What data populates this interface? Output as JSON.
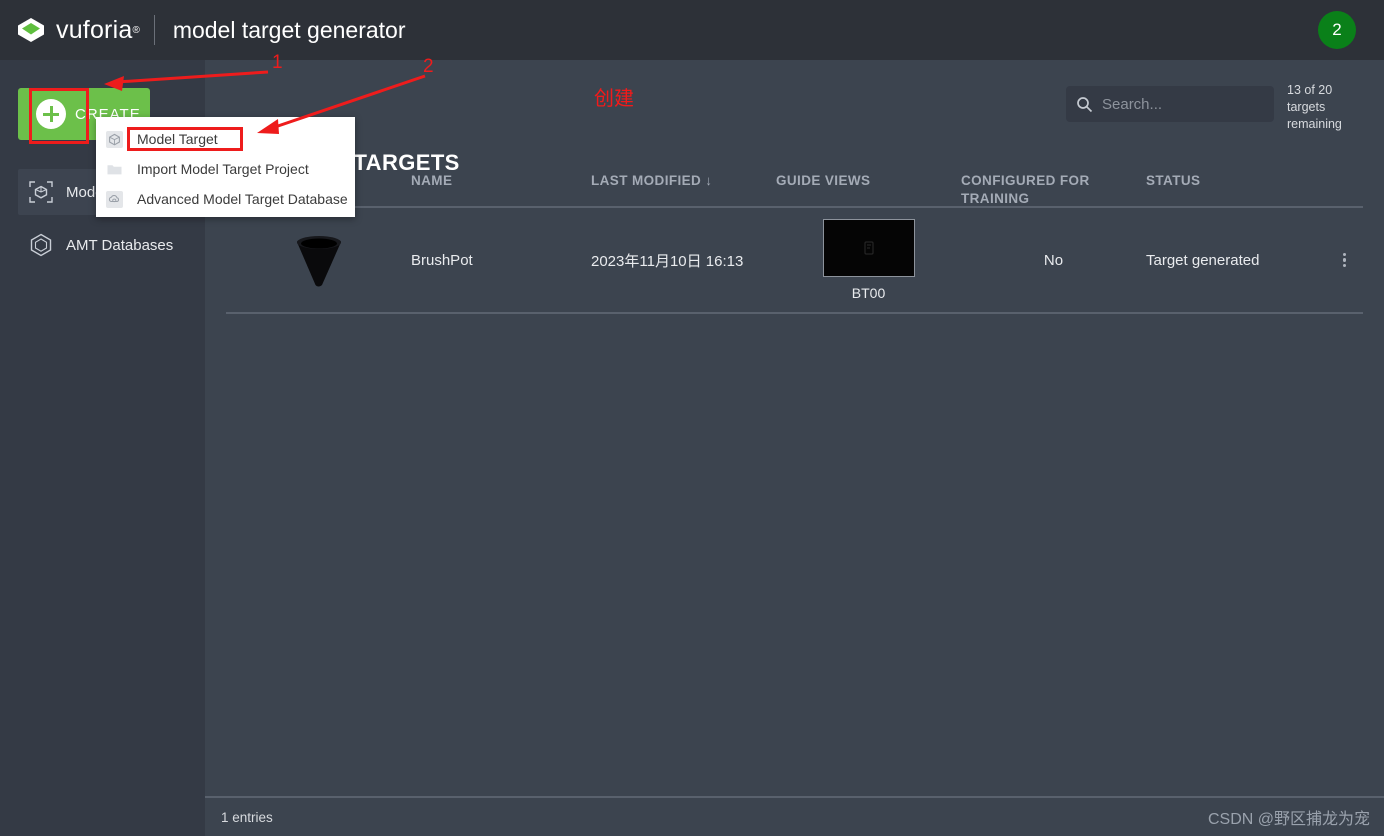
{
  "header": {
    "brand": "vuforia",
    "brand_registered": "®",
    "app_title": "model target generator",
    "user_badge": "2",
    "user_badge_color": "#0a8019"
  },
  "sidebar": {
    "create_button": {
      "label": "CREATE",
      "icon": "plus-circle-icon",
      "color": "#6cc04a"
    },
    "items": [
      {
        "label": "Model Targets",
        "icon": "model-target-icon",
        "active": true
      },
      {
        "label": "AMT Databases",
        "icon": "database-cube-icon",
        "active": false
      }
    ]
  },
  "create_menu": {
    "items": [
      {
        "label": "Model Target",
        "icon": "cube-icon",
        "highlighted": true
      },
      {
        "label": "Import Model Target Project",
        "icon": "folder-icon",
        "highlighted": false
      },
      {
        "label": "Advanced Model Target Database",
        "icon": "cloud-database-icon",
        "highlighted": false
      }
    ]
  },
  "main": {
    "page_title": "MY MODEL TARGETS",
    "search": {
      "placeholder": "Search...",
      "value": "",
      "icon": "search-icon"
    },
    "targets_remaining": "13 of 20 targets remaining",
    "table": {
      "columns": [
        "",
        "NAME",
        "LAST MODIFIED",
        "GUIDE VIEWS",
        "CONFIGURED FOR TRAINING",
        "STATUS",
        ""
      ],
      "sorted_column": "LAST MODIFIED",
      "sort_direction": "↓",
      "rows": [
        {
          "thumbnail": "brushpot-model-thumbnail",
          "name": "BrushPot",
          "last_modified": "2023年11月10日 16:13",
          "guide_view_label": "BT00",
          "configured_for_training": "No",
          "status": "Target generated",
          "menu": "row-overflow-menu"
        }
      ]
    }
  },
  "footer": {
    "entries": "1 entries",
    "watermark": "CSDN @野区捕龙为宠"
  },
  "annotations": {
    "color": "#ee1c1c",
    "markers": [
      {
        "id": "1",
        "label": "1",
        "points_to": "create-button"
      },
      {
        "id": "2",
        "label": "2",
        "points_to": "menu-item-model-target"
      }
    ],
    "chinese_note": "创建"
  }
}
